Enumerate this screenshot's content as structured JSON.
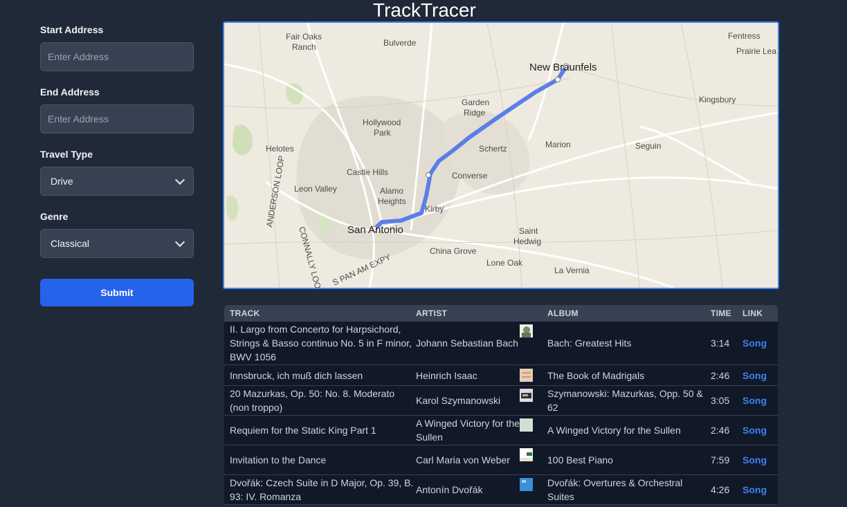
{
  "app": {
    "title": "TrackTracer"
  },
  "form": {
    "start": {
      "label": "Start Address",
      "placeholder": "Enter Address"
    },
    "end": {
      "label": "End Address",
      "placeholder": "Enter Address"
    },
    "travel": {
      "label": "Travel Type",
      "value": "Drive"
    },
    "genre": {
      "label": "Genre",
      "value": "Classical"
    },
    "submit_label": "Submit"
  },
  "map": {
    "places": {
      "fair_oaks_1": "Fair Oaks",
      "fair_oaks_2": "Ranch",
      "bulverde": "Bulverde",
      "new_braunfels": "New Braunfels",
      "fentress": "Fentress",
      "prairie_lea": "Prairie Lea",
      "kingsbury": "Kingsbury",
      "garden_ridge_1": "Garden",
      "garden_ridge_2": "Ridge",
      "hollywood_park_1": "Hollywood",
      "hollywood_park_2": "Park",
      "helotes": "Helotes",
      "schertz": "Schertz",
      "marion": "Marion",
      "seguin": "Seguin",
      "castle_hills": "Castle Hills",
      "converse": "Converse",
      "leon_valley": "Leon Valley",
      "alamo_heights_1": "Alamo",
      "alamo_heights_2": "Heights",
      "kirby": "Kirby",
      "san_antonio": "San Antonio",
      "saint_hedwig_1": "Saint",
      "saint_hedwig_2": "Hedwig",
      "china_grove": "China Grove",
      "lone_oak": "Lone Oak",
      "la_vernia": "La Vernia",
      "anderson_loop": "ANDERSON LOOP",
      "connally_loop": "CONNALLY LOOP",
      "s_pan_am": "S PAN AM EXPY"
    },
    "route_color": "#5b7fe8"
  },
  "table": {
    "headers": {
      "track": "TRACK",
      "artist": "ARTIST",
      "album": "ALBUM",
      "time": "TIME",
      "link": "LINK"
    },
    "rows": [
      {
        "track": "II. Largo from Concerto for Harpsichord, Strings & Basso continuo No. 5 in F minor, BWV 1056",
        "artist": "Johann Sebastian Bach",
        "album": "Bach: Greatest Hits",
        "time": "3:14",
        "link": "Song"
      },
      {
        "track": "Innsbruck, ich muß dich lassen",
        "artist": "Heinrich Isaac",
        "album": "The Book of Madrigals",
        "time": "2:46",
        "link": "Song"
      },
      {
        "track": "20 Mazurkas, Op. 50: No. 8. Moderato (non troppo)",
        "artist": "Karol Szymanowski",
        "album": "Szymanowski: Mazurkas, Opp. 50 & 62",
        "time": "3:05",
        "link": "Song"
      },
      {
        "track": "Requiem for the Static King Part 1",
        "artist": "A Winged Victory for the Sullen",
        "album": "A Winged Victory for the Sullen",
        "time": "2:46",
        "link": "Song"
      },
      {
        "track": "Invitation to the Dance",
        "artist": "Carl Maria von Weber",
        "album": "100 Best Piano",
        "time": "7:59",
        "link": "Song"
      },
      {
        "track": "Dvořák: Czech Suite in D Major, Op. 39, B. 93: IV. Romanza",
        "artist": "Antonín Dvořák",
        "album": "Dvořák: Overtures & Orchestral Suites",
        "time": "4:26",
        "link": "Song"
      }
    ]
  }
}
